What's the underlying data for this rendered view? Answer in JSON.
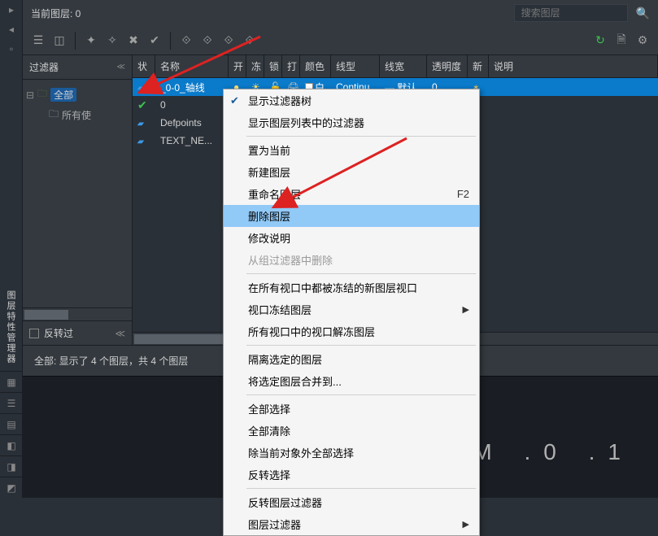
{
  "header": {
    "current_layer_label": "当前图层: 0",
    "search_placeholder": "搜索图层"
  },
  "panel": {
    "vertical_label": "图层特性管理器"
  },
  "filter": {
    "title": "过滤器",
    "root": "全部",
    "child": "所有使",
    "invert": "反转过"
  },
  "columns": {
    "status": "状",
    "name": "名称",
    "on": "开",
    "freeze": "冻",
    "lock": "锁",
    "print": "打",
    "color": "颜色",
    "linetype": "线型",
    "lineweight": "线宽",
    "transparency": "透明度",
    "newvp": "新",
    "description": "说明"
  },
  "rows": [
    {
      "name": "_0-0_轴线",
      "color_label": "白",
      "linetype": "Continu...",
      "lineweight": "— 默认",
      "transparency": "0",
      "selected": true
    },
    {
      "name": "0",
      "checked": true
    },
    {
      "name": "Defpoints"
    },
    {
      "name": "TEXT_NE..."
    }
  ],
  "status": "全部: 显示了 4 个图层，共 4 个图层",
  "context_menu": {
    "sections": [
      [
        {
          "label": "显示过滤器树",
          "checked": true
        },
        {
          "label": "显示图层列表中的过滤器"
        }
      ],
      [
        {
          "label": "置为当前"
        },
        {
          "label": "新建图层"
        },
        {
          "label": "重命名图层",
          "shortcut": "F2"
        },
        {
          "label": "删除图层",
          "highlight": true
        },
        {
          "label": "修改说明"
        },
        {
          "label": "从组过滤器中删除",
          "disabled": true
        }
      ],
      [
        {
          "label": "在所有视口中都被冻结的新图层视口"
        },
        {
          "label": "视口冻结图层",
          "submenu": true
        },
        {
          "label": "所有视口中的视口解冻图层"
        }
      ],
      [
        {
          "label": "隔离选定的图层"
        },
        {
          "label": "将选定图层合并到..."
        }
      ],
      [
        {
          "label": "全部选择"
        },
        {
          "label": "全部清除"
        },
        {
          "label": "除当前对象外全部选择"
        },
        {
          "label": "反转选择"
        }
      ],
      [
        {
          "label": "反转图层过滤器"
        },
        {
          "label": "图层过滤器",
          "submenu": true
        }
      ]
    ]
  },
  "bg_text": "OQ 4M  .0   .1",
  "icons": {
    "pin": "▣",
    "collapse": "◧",
    "refresh": "↻",
    "settings": "⚙",
    "search": "🔍"
  }
}
